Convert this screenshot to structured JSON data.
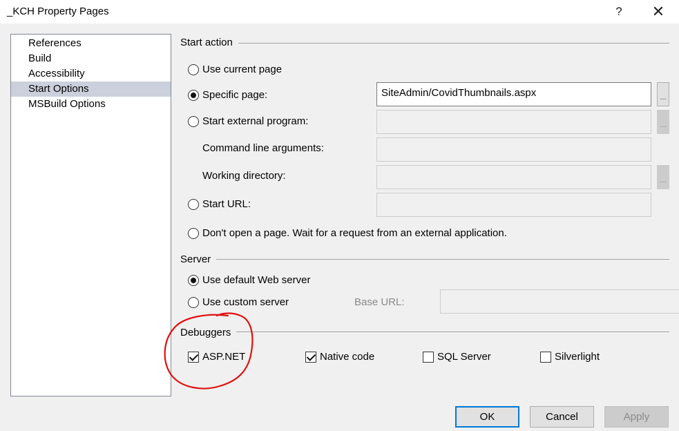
{
  "window": {
    "title": "_KCH Property Pages",
    "help_glyph": "?",
    "close_glyph": "✕"
  },
  "nav": {
    "items": [
      {
        "label": "References"
      },
      {
        "label": "Build"
      },
      {
        "label": "Accessibility"
      },
      {
        "label": "Start Options",
        "selected": true
      },
      {
        "label": "MSBuild Options"
      }
    ]
  },
  "start_action": {
    "title": "Start action",
    "use_current_page": "Use current page",
    "specific_page": "Specific page:",
    "specific_page_value": "SiteAdmin/CovidThumbnails.aspx",
    "start_external_program": "Start external program:",
    "command_line_arguments": "Command line arguments:",
    "working_directory": "Working directory:",
    "start_url": "Start URL:",
    "dont_open": "Don't open a page. Wait for a request from an external application.",
    "browse_label": "...",
    "selected": "specific_page"
  },
  "server": {
    "title": "Server",
    "use_default": "Use default Web server",
    "use_custom": "Use custom server",
    "base_url_label": "Base URL:",
    "selected": "use_default"
  },
  "debuggers": {
    "title": "Debuggers",
    "items": [
      {
        "label": "ASP.NET",
        "checked": true
      },
      {
        "label": "Native code",
        "checked": true
      },
      {
        "label": "SQL Server",
        "checked": false
      },
      {
        "label": "Silverlight",
        "checked": false
      }
    ]
  },
  "buttons": {
    "ok": "OK",
    "cancel": "Cancel",
    "apply": "Apply"
  },
  "colors": {
    "accent": "#0078d7",
    "selection": "#cbd0dc",
    "annotation": "#e01010"
  }
}
